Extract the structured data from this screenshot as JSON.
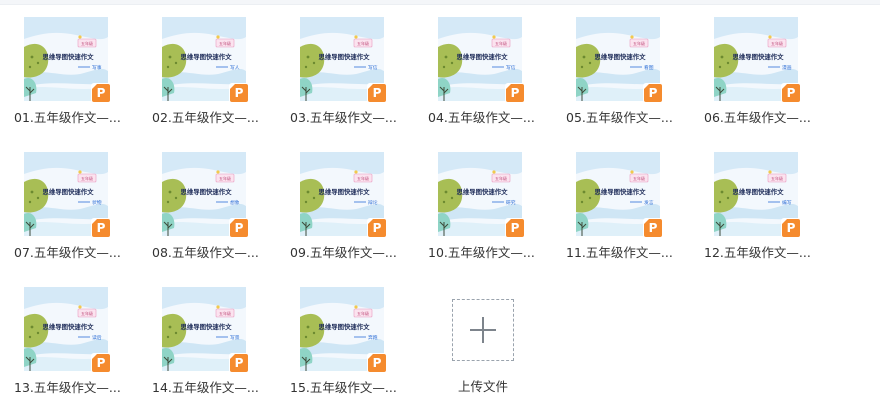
{
  "files": [
    {
      "name": "01.五年级作文—...",
      "slide_subtitle": "写事"
    },
    {
      "name": "02.五年级作文—...",
      "slide_subtitle": "写人"
    },
    {
      "name": "03.五年级作文—...",
      "slide_subtitle": "写信"
    },
    {
      "name": "04.五年级作文—...",
      "slide_subtitle": "写信"
    },
    {
      "name": "05.五年级作文—...",
      "slide_subtitle": "看图"
    },
    {
      "name": "06.五年级作文—...",
      "slide_subtitle": "漫画"
    },
    {
      "name": "07.五年级作文—...",
      "slide_subtitle": "状物"
    },
    {
      "name": "08.五年级作文—...",
      "slide_subtitle": "想象"
    },
    {
      "name": "09.五年级作文—...",
      "slide_subtitle": "辩论"
    },
    {
      "name": "10.五年级作文—...",
      "slide_subtitle": "研究"
    },
    {
      "name": "11.五年级作文—...",
      "slide_subtitle": "发言"
    },
    {
      "name": "12.五年级作文—...",
      "slide_subtitle": "编写"
    },
    {
      "name": "13.五年级作文—...",
      "slide_subtitle": "读后"
    },
    {
      "name": "14.五年级作文—...",
      "slide_subtitle": "写景"
    },
    {
      "name": "15.五年级作文—...",
      "slide_subtitle": "奔跑"
    }
  ],
  "slide": {
    "title": "思维导图快速作文",
    "tag": "五年级"
  },
  "file_badge": "P",
  "upload": {
    "label": "上传文件",
    "icon": "plus-icon"
  },
  "colors": {
    "badge": "#f58b2e",
    "slide_text": "#1f2d5a",
    "slide_accent": "#2f6fd6"
  }
}
